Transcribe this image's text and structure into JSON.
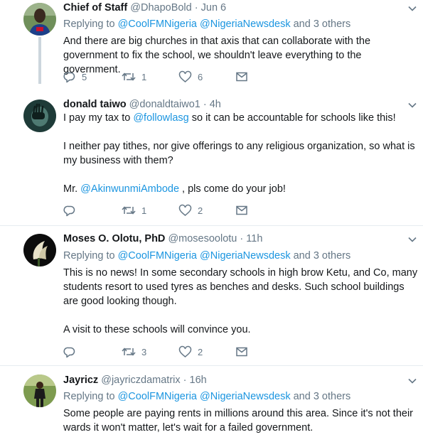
{
  "tweets": [
    {
      "name": "Chief of Staff",
      "handle": "@DhapoBold",
      "time": "Jun 6",
      "replying_prefix": "Replying to",
      "mentions": [
        "@CoolFMNigeria",
        "@NigeriaNewsdesk"
      ],
      "others": "and 3 others",
      "text": "And there are big churches in that axis that can collaborate with the government to fix the school, we shouldn't leave everything to the government.",
      "replies": "5",
      "retweets": "1",
      "likes": "6"
    },
    {
      "name": "donald taiwo",
      "handle": "@donaldtaiwo1",
      "time": "4h",
      "para1_before": "I pay my tax to ",
      "para1_link": "@followlasg",
      "para1_after": " so it can be accountable for schools like this!",
      "para2": "I neither pay tithes, nor give offerings to any religious organization, so what is my business with them?",
      "para3_before": "Mr. ",
      "para3_link": "@AkinwunmiAmbode",
      "para3_after": " , pls come do your job!",
      "replies": "",
      "retweets": "1",
      "likes": "2"
    },
    {
      "name": "Moses O. Olotu, PhD",
      "handle": "@mosesoolotu",
      "time": "11h",
      "replying_prefix": "Replying to",
      "mentions": [
        "@CoolFMNigeria",
        "@NigeriaNewsdesk"
      ],
      "others": "and 3 others",
      "para1": "This is no news! In some secondary schools in high brow Ketu,  and Co,  many students resort to used tyres as benches and desks. Such school buildings are good looking though.",
      "para2": "A visit to these schools will convince you.",
      "replies": "",
      "retweets": "3",
      "likes": "2"
    },
    {
      "name": "Jayricz",
      "handle": "@jayriczdamatrix",
      "time": "16h",
      "replying_prefix": "Replying to",
      "mentions": [
        "@CoolFMNigeria",
        "@NigeriaNewsdesk"
      ],
      "others": "and 3 others",
      "text": "Some people are paying rents in millions around this area. Since it's not their wards it won't matter, let's wait for a failed government."
    }
  ],
  "separator": "·",
  "colors": {
    "link": "#1b95e0",
    "muted": "#657786",
    "divider": "#e6ecf0",
    "thread": "#ccd6dd"
  },
  "icons": [
    "reply-icon",
    "retweet-icon",
    "like-icon",
    "message-icon",
    "chevron-down-icon"
  ]
}
